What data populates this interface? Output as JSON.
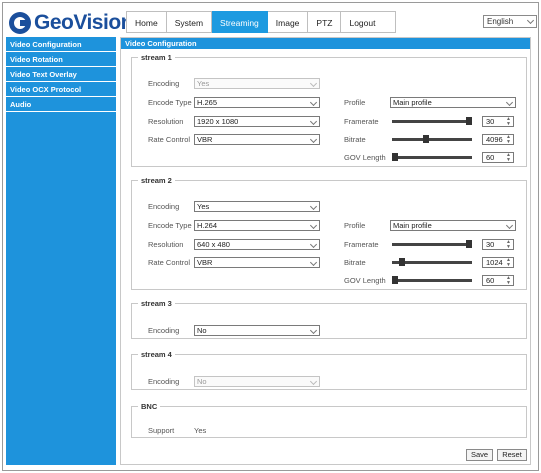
{
  "brand": {
    "name": "GeoVision"
  },
  "nav": {
    "tabs": [
      "Home",
      "System",
      "Streaming",
      "Image",
      "PTZ",
      "Logout"
    ],
    "active": "Streaming"
  },
  "language": {
    "selected": "English"
  },
  "sidebar": {
    "items": [
      {
        "label": "Video Configuration"
      },
      {
        "label": "Video Rotation"
      },
      {
        "label": "Video Text Overlay"
      },
      {
        "label": "Video OCX Protocol"
      },
      {
        "label": "Audio"
      }
    ]
  },
  "content": {
    "title": "Video Configuration"
  },
  "labels": {
    "encoding": "Encoding",
    "encode_type": "Encode Type",
    "resolution": "Resolution",
    "rate_control": "Rate Control",
    "profile": "Profile",
    "framerate": "Framerate",
    "bitrate": "Bitrate",
    "gov_length": "GOV Length",
    "support": "Support"
  },
  "stream1": {
    "title": "stream 1",
    "encoding": "Yes",
    "encode_type": "H.265",
    "resolution": "1920 x 1080",
    "rate_control": "VBR",
    "profile": "Main profile",
    "framerate": "30",
    "bitrate": "4096",
    "gov_length": "60",
    "framerate_level": 1.0,
    "bitrate_level": 0.42,
    "gov_level": 0.0
  },
  "stream2": {
    "title": "stream 2",
    "encoding": "Yes",
    "encode_type": "H.264",
    "resolution": "640 x 480",
    "rate_control": "VBR",
    "profile": "Main profile",
    "framerate": "30",
    "bitrate": "1024",
    "gov_length": "60",
    "framerate_level": 1.0,
    "bitrate_level": 0.1,
    "gov_level": 0.0
  },
  "stream3": {
    "title": "stream 3",
    "encoding": "No"
  },
  "stream4": {
    "title": "stream 4",
    "encoding": "No"
  },
  "bnc": {
    "title": "BNC",
    "support": "Yes"
  },
  "buttons": {
    "save": "Save",
    "reset": "Reset"
  },
  "colors": {
    "accent": "#1e93dc",
    "brand": "#1b4f9c"
  }
}
